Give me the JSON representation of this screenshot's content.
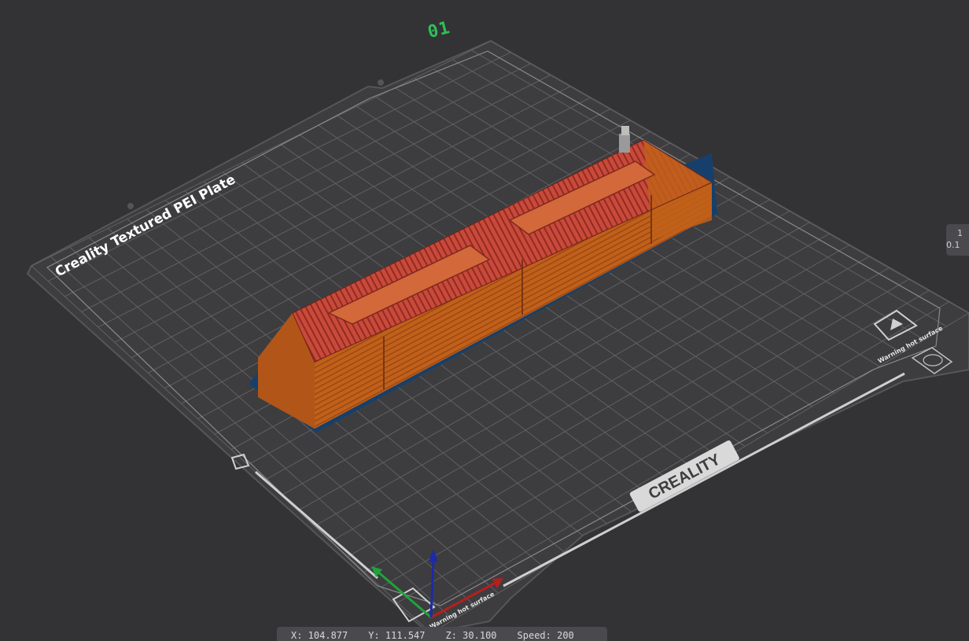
{
  "plate": {
    "number": "01",
    "label": "Creality Textured PEI Plate",
    "brand_logo": "CREALITY",
    "warning_text": "Warning hot surface",
    "warning_icon": "hot-surface-warning-icon",
    "fingerprint_icon": "fingerprint-icon"
  },
  "colors": {
    "background": "#333335",
    "plate": "#3d3d40",
    "grid": "#6c6c6e",
    "model_wall": "#c0601a",
    "model_top": "#c84a3a",
    "brim": "#16406b",
    "plate_number": "#2fbf5a",
    "axis_x": "#b81e1e",
    "axis_y": "#1fa33a",
    "axis_z": "#1d2aa8"
  },
  "side_widget": {
    "line1": "1",
    "line2": "0.1"
  },
  "status_bar": {
    "x": "X: 104.877",
    "y": "Y: 111.547",
    "z": "Z: 30.100",
    "speed": "Speed: 200"
  }
}
